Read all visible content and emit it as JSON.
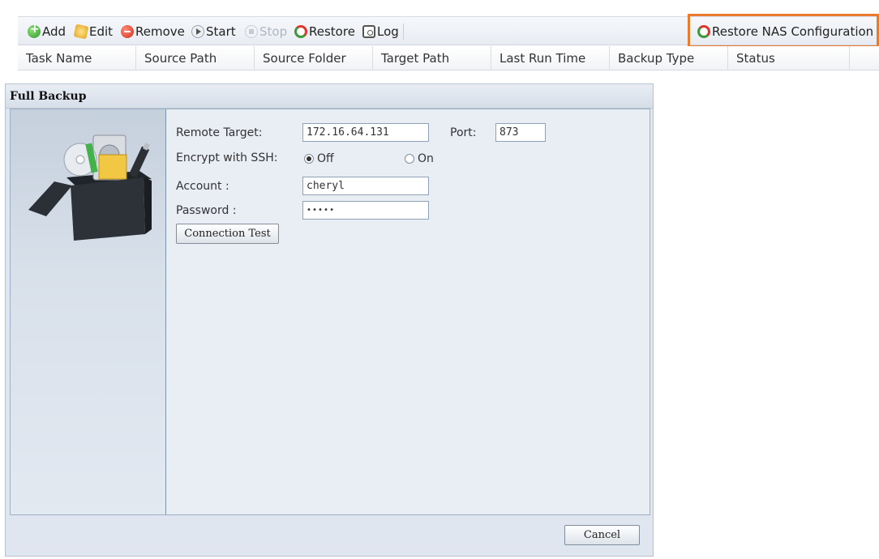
{
  "toolbar": {
    "add": "Add",
    "edit": "Edit",
    "remove": "Remove",
    "start": "Start",
    "stop": "Stop",
    "restore": "Restore",
    "log": "Log",
    "restore_nas": "Restore NAS Configuration"
  },
  "columns": [
    "Task Name",
    "Source Path",
    "Source Folder",
    "Target Path",
    "Last Run Time",
    "Backup Type",
    "Status"
  ],
  "highlight_color": "#ec7a2c",
  "dialog": {
    "title": "Full Backup",
    "remote_target_label": "Remote Target:",
    "remote_target_value": "172.16.64.131",
    "port_label": "Port:",
    "port_value": "873",
    "encrypt_label": "Encrypt with SSH:",
    "encrypt_off": "Off",
    "encrypt_on": "On",
    "encrypt_selected": "Off",
    "account_label": "Account :",
    "account_value": "cheryl",
    "password_label": "Password :",
    "password_value": "•••••",
    "connection_test": "Connection Test",
    "cancel": "Cancel"
  }
}
